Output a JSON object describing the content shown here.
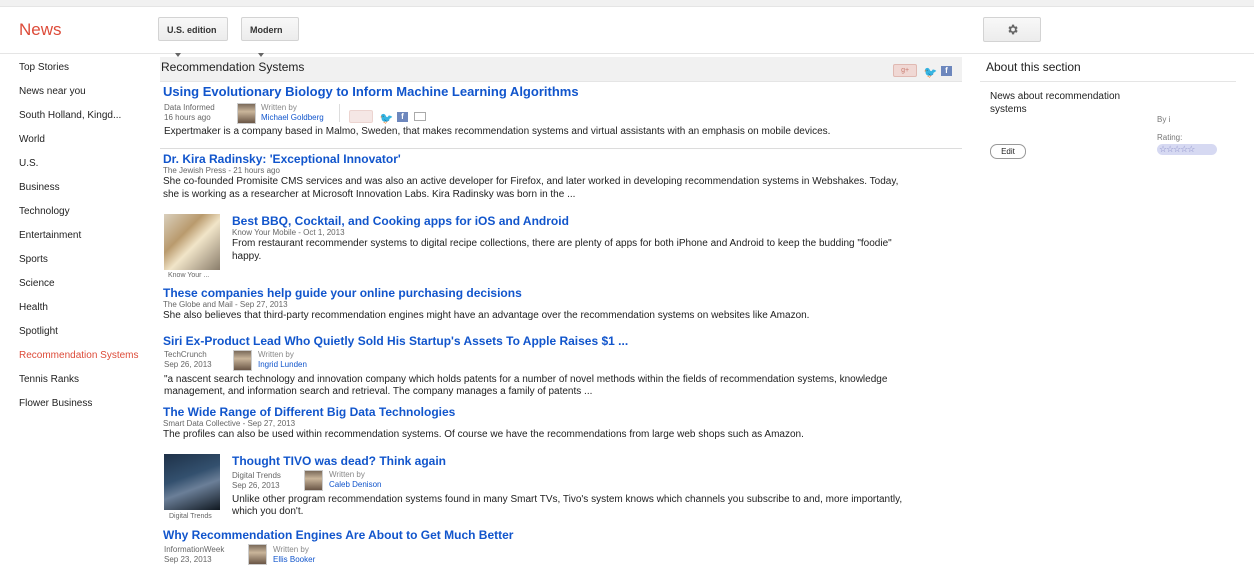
{
  "header": {
    "logo": "News",
    "edition": "U.S. edition",
    "view": "Modern"
  },
  "nav": [
    {
      "label": "Top Stories"
    },
    {
      "label": "News near you"
    },
    {
      "label": "South Holland, Kingd..."
    },
    {
      "label": "World"
    },
    {
      "label": "U.S."
    },
    {
      "label": "Business"
    },
    {
      "label": "Technology"
    },
    {
      "label": "Entertainment"
    },
    {
      "label": "Sports"
    },
    {
      "label": "Science"
    },
    {
      "label": "Health"
    },
    {
      "label": "Spotlight"
    },
    {
      "label": "Recommendation Systems",
      "active": true
    },
    {
      "label": "Tennis Ranks"
    },
    {
      "label": "Flower Business"
    }
  ],
  "section": {
    "title": "Recommendation Systems",
    "share_gplus": "g+"
  },
  "articles": [
    {
      "title": "Using Evolutionary Biology to Inform Machine Learning Algorithms",
      "source": "Data Informed",
      "time": "16 hours ago",
      "written_by": "Written by",
      "author": "Michael Goldberg",
      "snippet": "Expertmaker is a company based in Malmo, Sweden, that makes recommendation systems and virtual assistants with an emphasis on mobile devices."
    },
    {
      "title": "Dr. Kira Radinsky: 'Exceptional Innovator'",
      "source_time": "The Jewish Press - 21 hours ago",
      "snippet1": "She co-founded Promisite CMS services and was also an active developer for Firefox, and later worked in developing recommendation systems in Webshakes. Today,",
      "snippet2": "she is working as a researcher at Microsoft Innovation Labs. Kira Radinsky was born in the ..."
    },
    {
      "title": "Best BBQ, Cocktail, and Cooking apps for iOS and Android",
      "source_time": "Know Your Mobile - Oct 1, 2013",
      "thumb_caption": "Know Your ...",
      "snippet1": "From restaurant recommender systems to digital recipe collections, there are plenty of apps for both iPhone and Android to keep the budding \"foodie\"",
      "snippet2": "happy."
    },
    {
      "title": "These companies help guide your online purchasing decisions",
      "source_time": "The Globe and Mail - Sep 27, 2013",
      "snippet": "She also believes that third-party recommendation engines might have an advantage over the recommendation systems on websites like Amazon."
    },
    {
      "title": "Siri Ex-Product Lead Who Quietly Sold His Startup's Assets To Apple Raises $1 ...",
      "source": "TechCrunch",
      "time": "Sep 26, 2013",
      "written_by": "Written by",
      "author": "Ingrid Lunden",
      "snippet1": "\"a nascent search technology and innovation company which holds patents for a number of novel methods within the fields of recommendation systems, knowledge",
      "snippet2": "management, and information search and retrieval. The company manages a family of patents ..."
    },
    {
      "title": "The Wide Range of Different Big Data Technologies",
      "source_time": "Smart Data Collective - Sep 27, 2013",
      "snippet": "The profiles can also be used within recommendation systems. Of course we have the recommendations from large web shops such as Amazon."
    },
    {
      "title": "Thought TIVO was dead? Think again",
      "source": "Digital Trends",
      "time": "Sep 26, 2013",
      "written_by": "Written by",
      "author": "Caleb Denison",
      "thumb_caption": "Digital Trends",
      "snippet1": "Unlike other program recommendation systems found in many Smart TVs, Tivo's system knows which channels you subscribe to and, more importantly,",
      "snippet2": "which you don't."
    },
    {
      "title": "Why Recommendation Engines Are About to Get Much Better",
      "source": "InformationWeek",
      "time": "Sep 23, 2013",
      "written_by": "Written by",
      "author": "Ellis Booker"
    }
  ],
  "about": {
    "heading": "About this section",
    "description": "News about recommendation systems",
    "edit": "Edit",
    "by": "By i",
    "rating_label": "Rating:",
    "stars": "☆☆☆☆☆"
  },
  "colors": {
    "accent_red": "#dd4b39",
    "link_blue": "#1155cc"
  }
}
